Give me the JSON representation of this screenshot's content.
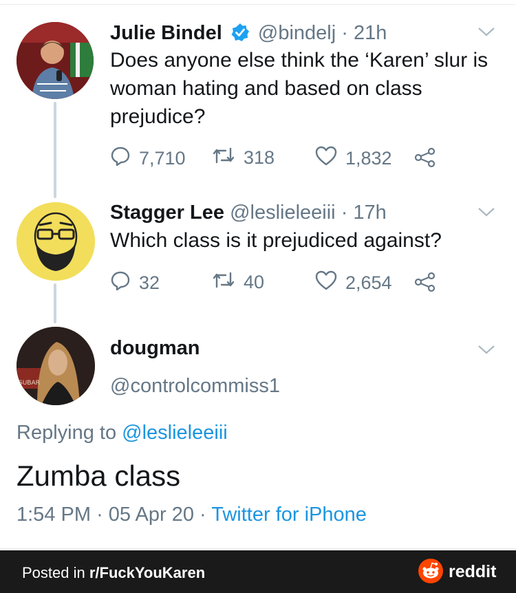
{
  "tweets": [
    {
      "name": "Julie Bindel",
      "handle": "@bindelj",
      "separator": "·",
      "time": "21h",
      "text": "Does anyone else think the ‘Karen’ slur is woman hating and based on class prejudice?",
      "replies": "7,710",
      "retweets": "318",
      "likes": "1,832",
      "verified": true
    },
    {
      "name": "Stagger Lee",
      "handle": "@leslieleeiii",
      "separator": "·",
      "time": "17h",
      "text": "Which class is it prejudiced against?",
      "replies": "32",
      "retweets": "40",
      "likes": "2,654"
    }
  ],
  "main_tweet": {
    "name": "dougman",
    "handle": "@controlcommiss1",
    "replying_prefix": "Replying to",
    "replying_handle": "@leslieleeiii",
    "text": "Zumba class",
    "time": "1:54 PM",
    "separator": "·",
    "date": "05 Apr 20",
    "client": "Twitter for iPhone"
  },
  "footer": {
    "posted_prefix": "Posted in",
    "subreddit": "r/FuckYouKaren",
    "brand": "reddit"
  },
  "colors": {
    "link": "#1b95e0",
    "muted": "#657786",
    "verified": "#1da1f2",
    "reddit_orange": "#ff4500",
    "footer_bg": "#1a1a1b"
  },
  "icons": [
    "verified-badge-icon",
    "chevron-down-icon",
    "reply-icon",
    "retweet-icon",
    "like-icon",
    "share-icon",
    "reddit-snoo-icon"
  ]
}
